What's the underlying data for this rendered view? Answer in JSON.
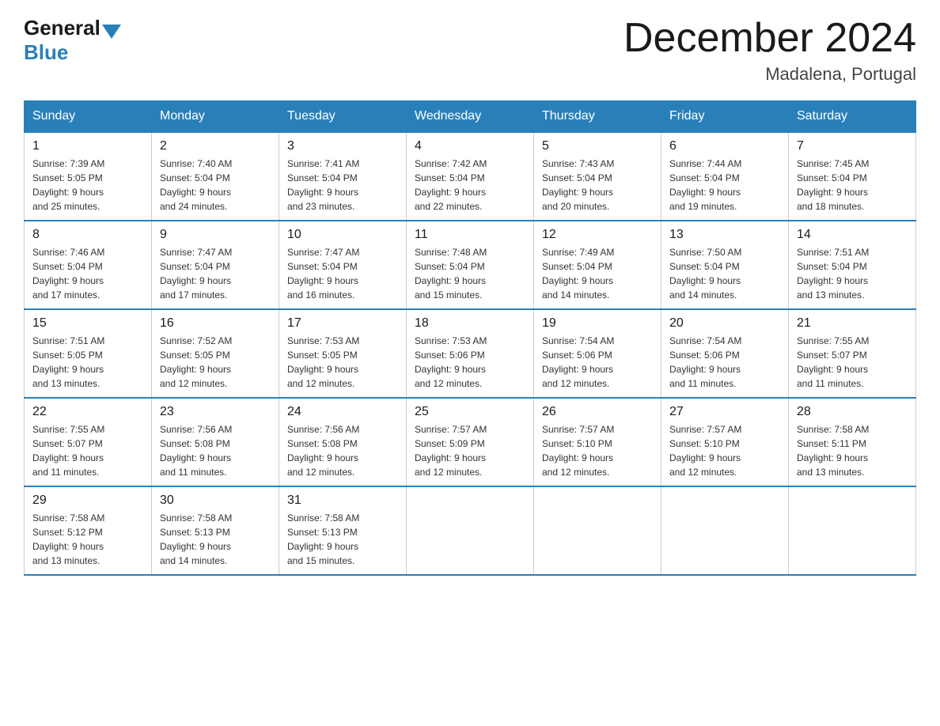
{
  "header": {
    "logo_general": "General",
    "logo_blue": "Blue",
    "title": "December 2024",
    "subtitle": "Madalena, Portugal"
  },
  "days_of_week": [
    "Sunday",
    "Monday",
    "Tuesday",
    "Wednesday",
    "Thursday",
    "Friday",
    "Saturday"
  ],
  "weeks": [
    [
      {
        "day": "1",
        "sunrise": "7:39 AM",
        "sunset": "5:05 PM",
        "daylight": "9 hours and 25 minutes."
      },
      {
        "day": "2",
        "sunrise": "7:40 AM",
        "sunset": "5:04 PM",
        "daylight": "9 hours and 24 minutes."
      },
      {
        "day": "3",
        "sunrise": "7:41 AM",
        "sunset": "5:04 PM",
        "daylight": "9 hours and 23 minutes."
      },
      {
        "day": "4",
        "sunrise": "7:42 AM",
        "sunset": "5:04 PM",
        "daylight": "9 hours and 22 minutes."
      },
      {
        "day": "5",
        "sunrise": "7:43 AM",
        "sunset": "5:04 PM",
        "daylight": "9 hours and 20 minutes."
      },
      {
        "day": "6",
        "sunrise": "7:44 AM",
        "sunset": "5:04 PM",
        "daylight": "9 hours and 19 minutes."
      },
      {
        "day": "7",
        "sunrise": "7:45 AM",
        "sunset": "5:04 PM",
        "daylight": "9 hours and 18 minutes."
      }
    ],
    [
      {
        "day": "8",
        "sunrise": "7:46 AM",
        "sunset": "5:04 PM",
        "daylight": "9 hours and 17 minutes."
      },
      {
        "day": "9",
        "sunrise": "7:47 AM",
        "sunset": "5:04 PM",
        "daylight": "9 hours and 17 minutes."
      },
      {
        "day": "10",
        "sunrise": "7:47 AM",
        "sunset": "5:04 PM",
        "daylight": "9 hours and 16 minutes."
      },
      {
        "day": "11",
        "sunrise": "7:48 AM",
        "sunset": "5:04 PM",
        "daylight": "9 hours and 15 minutes."
      },
      {
        "day": "12",
        "sunrise": "7:49 AM",
        "sunset": "5:04 PM",
        "daylight": "9 hours and 14 minutes."
      },
      {
        "day": "13",
        "sunrise": "7:50 AM",
        "sunset": "5:04 PM",
        "daylight": "9 hours and 14 minutes."
      },
      {
        "day": "14",
        "sunrise": "7:51 AM",
        "sunset": "5:04 PM",
        "daylight": "9 hours and 13 minutes."
      }
    ],
    [
      {
        "day": "15",
        "sunrise": "7:51 AM",
        "sunset": "5:05 PM",
        "daylight": "9 hours and 13 minutes."
      },
      {
        "day": "16",
        "sunrise": "7:52 AM",
        "sunset": "5:05 PM",
        "daylight": "9 hours and 12 minutes."
      },
      {
        "day": "17",
        "sunrise": "7:53 AM",
        "sunset": "5:05 PM",
        "daylight": "9 hours and 12 minutes."
      },
      {
        "day": "18",
        "sunrise": "7:53 AM",
        "sunset": "5:06 PM",
        "daylight": "9 hours and 12 minutes."
      },
      {
        "day": "19",
        "sunrise": "7:54 AM",
        "sunset": "5:06 PM",
        "daylight": "9 hours and 12 minutes."
      },
      {
        "day": "20",
        "sunrise": "7:54 AM",
        "sunset": "5:06 PM",
        "daylight": "9 hours and 11 minutes."
      },
      {
        "day": "21",
        "sunrise": "7:55 AM",
        "sunset": "5:07 PM",
        "daylight": "9 hours and 11 minutes."
      }
    ],
    [
      {
        "day": "22",
        "sunrise": "7:55 AM",
        "sunset": "5:07 PM",
        "daylight": "9 hours and 11 minutes."
      },
      {
        "day": "23",
        "sunrise": "7:56 AM",
        "sunset": "5:08 PM",
        "daylight": "9 hours and 11 minutes."
      },
      {
        "day": "24",
        "sunrise": "7:56 AM",
        "sunset": "5:08 PM",
        "daylight": "9 hours and 12 minutes."
      },
      {
        "day": "25",
        "sunrise": "7:57 AM",
        "sunset": "5:09 PM",
        "daylight": "9 hours and 12 minutes."
      },
      {
        "day": "26",
        "sunrise": "7:57 AM",
        "sunset": "5:10 PM",
        "daylight": "9 hours and 12 minutes."
      },
      {
        "day": "27",
        "sunrise": "7:57 AM",
        "sunset": "5:10 PM",
        "daylight": "9 hours and 12 minutes."
      },
      {
        "day": "28",
        "sunrise": "7:58 AM",
        "sunset": "5:11 PM",
        "daylight": "9 hours and 13 minutes."
      }
    ],
    [
      {
        "day": "29",
        "sunrise": "7:58 AM",
        "sunset": "5:12 PM",
        "daylight": "9 hours and 13 minutes."
      },
      {
        "day": "30",
        "sunrise": "7:58 AM",
        "sunset": "5:13 PM",
        "daylight": "9 hours and 14 minutes."
      },
      {
        "day": "31",
        "sunrise": "7:58 AM",
        "sunset": "5:13 PM",
        "daylight": "9 hours and 15 minutes."
      },
      null,
      null,
      null,
      null
    ]
  ]
}
